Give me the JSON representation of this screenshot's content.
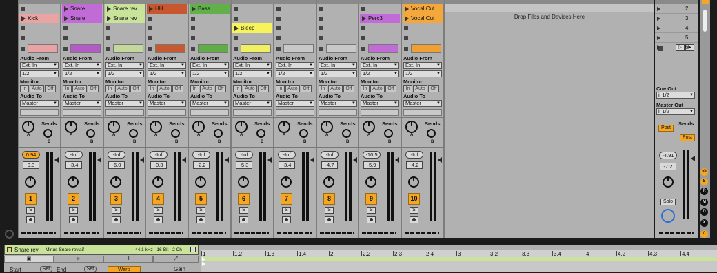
{
  "tracks": [
    {
      "num": "1",
      "volume": "0.94",
      "pan": "0.3",
      "color": "#e9a3a3",
      "clips": [
        {
          "row": 1,
          "label": "Kick",
          "color": "#e9a3a3"
        }
      ],
      "vol_active": true
    },
    {
      "num": "2",
      "volume": "-Inf",
      "pan": "-3.4",
      "color": "#b55bc7",
      "clips": [
        {
          "row": 0,
          "label": "Snare",
          "color": "#c16cd6"
        },
        {
          "row": 1,
          "label": "Snare",
          "color": "#c16cd6"
        }
      ],
      "vol_active": false
    },
    {
      "num": "3",
      "volume": "-Inf",
      "pan": "-6.0",
      "color": "#c3d89b",
      "clips": [
        {
          "row": 0,
          "label": "Snare rev",
          "color": "#c9e39b"
        },
        {
          "row": 1,
          "label": "Snare rev",
          "color": "#c9e39b"
        }
      ],
      "vol_active": false
    },
    {
      "num": "4",
      "volume": "-Inf",
      "pan": "-0.3",
      "color": "#c85a32",
      "clips": [
        {
          "row": 0,
          "label": "HH",
          "color": "#c8562f"
        }
      ],
      "vol_active": false
    },
    {
      "num": "5",
      "volume": "-Inf",
      "pan": "-2.2",
      "color": "#5fae45",
      "clips": [
        {
          "row": 0,
          "label": "Bass",
          "color": "#62b04a"
        }
      ],
      "vol_active": false
    },
    {
      "num": "6",
      "volume": "-Inf",
      "pan": "-5.3",
      "color": "#f0f060",
      "clips": [
        {
          "row": 2,
          "label": "Bleep",
          "color": "#f6f45a"
        }
      ],
      "vol_active": false
    },
    {
      "num": "7",
      "volume": "-Inf",
      "pan": "-3.4",
      "color": "#b1b1b1",
      "clips": [],
      "vol_active": false
    },
    {
      "num": "8",
      "volume": "-Inf",
      "pan": "-4.7",
      "color": "#b1b1b1",
      "clips": [],
      "vol_active": false
    },
    {
      "num": "9",
      "volume": "-10.5",
      "pan": "-5.9",
      "color": "#c16cd6",
      "clips": [
        {
          "row": 1,
          "label": "Perc3",
          "color": "#c16cd6"
        }
      ],
      "vol_active": false
    },
    {
      "num": "10",
      "volume": "-Inf",
      "pan": "-4.2",
      "color": "#f0a030",
      "clips": [
        {
          "row": 0,
          "label": "Vocal Cut",
          "color": "#f4a73a"
        },
        {
          "row": 1,
          "label": "Vocal Cut",
          "color": "#f4a73a"
        }
      ],
      "vol_active": false
    }
  ],
  "io": {
    "audio_from": "Audio From",
    "ext_in": "Ext. In",
    "ch": "1/2",
    "monitor": "Monitor",
    "mon_in": "In",
    "mon_auto": "Auto",
    "mon_off": "Off",
    "audio_to": "Audio To",
    "master": "Master"
  },
  "sends": {
    "label": "Sends",
    "a": "A",
    "b": "B"
  },
  "solo_btn": "S",
  "drop_text": "Drop Files and Devices Here",
  "master": {
    "scenes": [
      "2",
      "3",
      "4",
      "5",
      "6"
    ],
    "cue_out": "Cue Out",
    "cue_val": "ii 1/2",
    "master_out": "Master Out",
    "master_val": "ii 1/2",
    "sends": "Sends",
    "post": "Post",
    "volume": "-4.91",
    "pan": "-7.2",
    "solo": "Solo"
  },
  "side_icons": [
    {
      "label": "IO",
      "color": "#f5a623"
    },
    {
      "label": "S",
      "color": "#f5a623"
    },
    {
      "label": "R",
      "color": "#111"
    },
    {
      "label": "M",
      "color": "#111"
    },
    {
      "label": "D",
      "color": "#111"
    },
    {
      "label": "X",
      "color": "#111"
    },
    {
      "label": "C",
      "color": "#f5a623"
    }
  ],
  "clip_view": {
    "clip_name": "Snare rev",
    "file": "Minus-Snare rev.aif",
    "info": "44.1 kHz · 16-Bit · 2 Ch",
    "start": "Start",
    "end": "End",
    "set": "Set",
    "warp": "Warp",
    "gain": "Gain",
    "ruler": [
      "1",
      "1.2",
      "1.3",
      "1.4",
      "2",
      "2.2",
      "2.3",
      "2.4",
      "3",
      "3.2",
      "3.3",
      "3.4",
      "4",
      "4.2",
      "4.3",
      "4.4"
    ]
  }
}
